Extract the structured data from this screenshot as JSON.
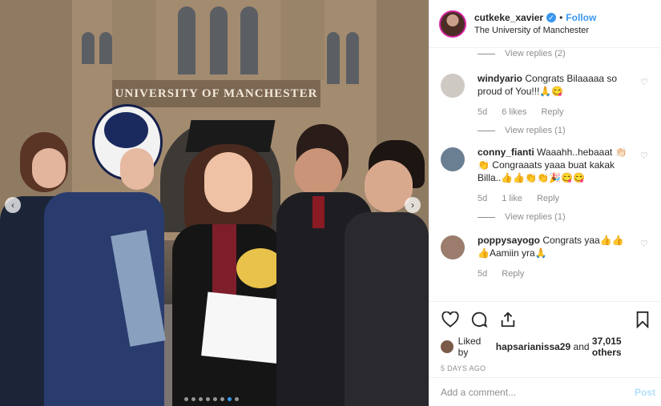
{
  "post": {
    "username": "cutkeke_xavier",
    "separator": "•",
    "follow_label": "Follow",
    "location": "The University of Manchester",
    "photo_sign": "UNIVERSITY OF MANCHESTER",
    "carousel": {
      "count": 8,
      "active_index": 6
    }
  },
  "comments": {
    "top_view_replies": "View replies (2)",
    "items": [
      {
        "username": "windyario",
        "text": "Congrats Bilaaaaa so proud of You!!!🙏😋",
        "time": "5d",
        "likes": "6 likes",
        "reply": "Reply",
        "view_replies": "View replies (1)",
        "avatar_color": "#cfc9c4"
      },
      {
        "username": "conny_fianti",
        "text": "Waaahh..hebaaat 👏🏻👏 Congraaats yaaa buat kakak Billa..👍👍👏👏🎉😋😋",
        "time": "5d",
        "likes": "1 like",
        "reply": "Reply",
        "view_replies": "View replies (1)",
        "avatar_color": "#6b7f93"
      },
      {
        "username": "poppysayogo",
        "text": "Congrats yaa👍👍 👍Aamiin yra🙏",
        "time": "5d",
        "reply": "Reply",
        "avatar_color": "#9b7c6d"
      }
    ]
  },
  "actions": {
    "liked_by_prefix": "Liked by",
    "liked_by_user": "hapsarianissa29",
    "liked_by_and": "and",
    "others_count": "37,015 others",
    "date": "5 DAYS AGO"
  },
  "add_comment": {
    "placeholder": "Add a comment...",
    "post_label": "Post"
  },
  "colors": {
    "accent": "#3897f0",
    "post_disabled": "#b2dffc",
    "meta_gray": "#8e8e8e"
  }
}
